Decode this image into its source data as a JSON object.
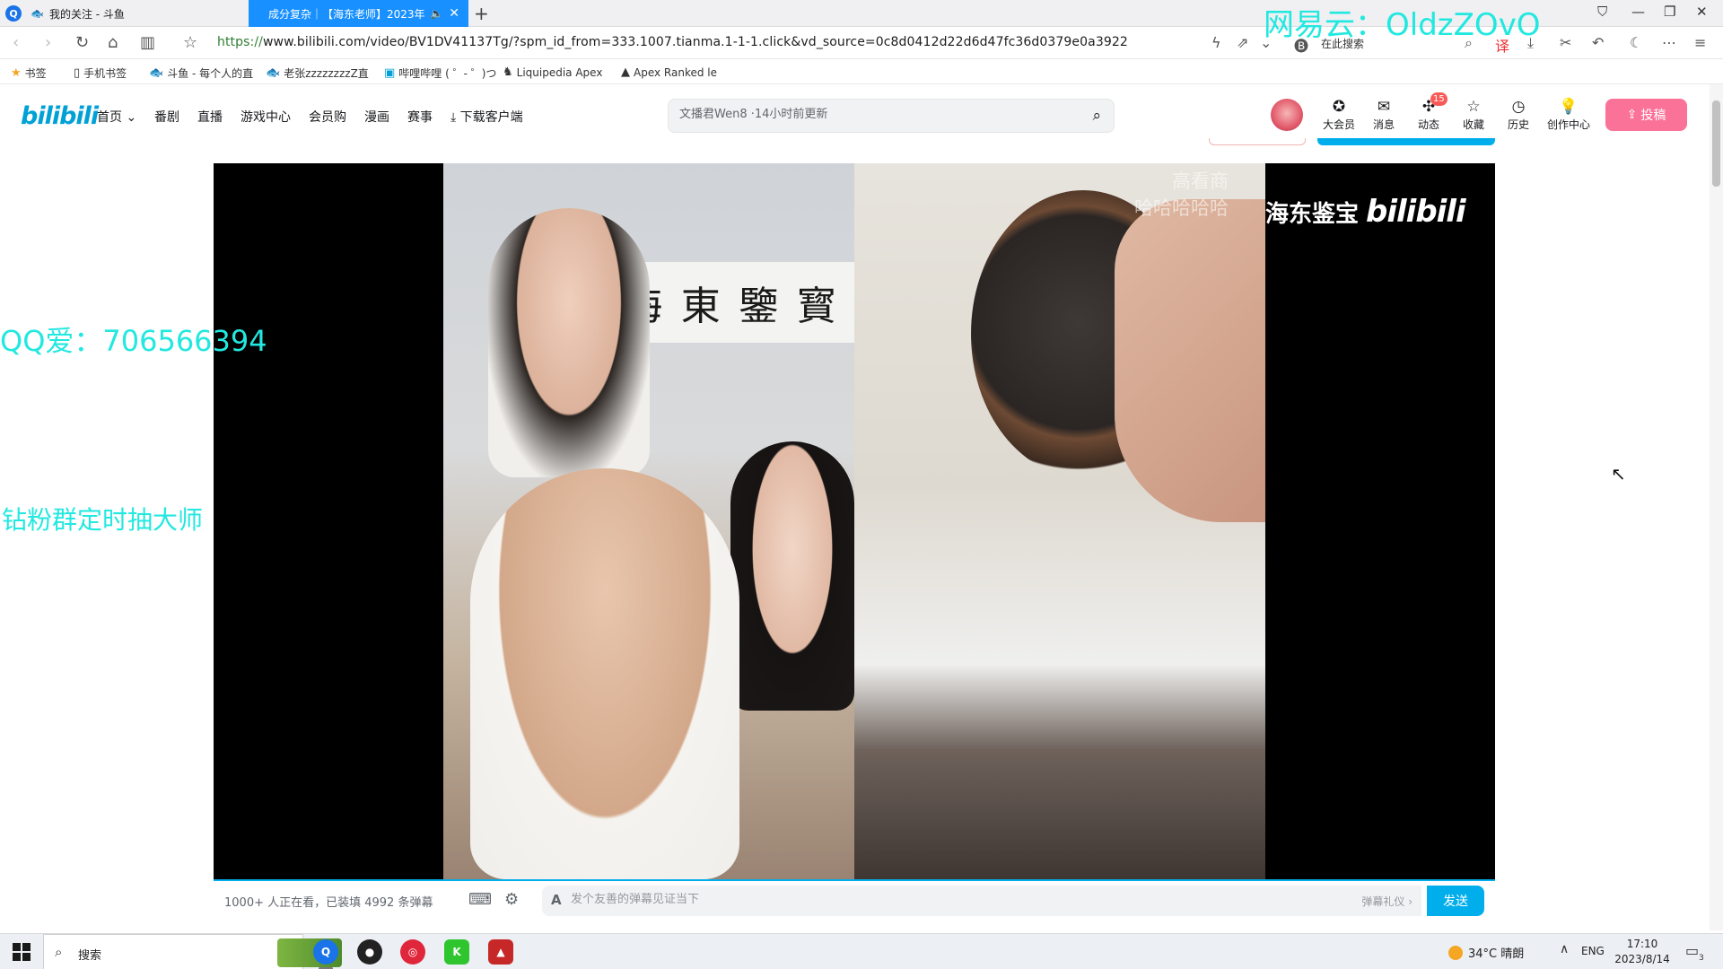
{
  "browser": {
    "tabs": [
      {
        "label": "我的关注 - 斗鱼",
        "active": false
      },
      {
        "label": "成分复杂｜【海东老师】2023年",
        "active": true
      }
    ],
    "url_scheme": "https://",
    "url_rest": "www.bilibili.com/video/BV1DV41137Tg/?spm_id_from=333.1007.tianma.1-1-1.click&vd_source=0c8d0412d22d6d47fc36d0379e0a3922",
    "search_engine_label": "在此搜索",
    "bookmarks": [
      {
        "label": "书签",
        "icon": "star-icon"
      },
      {
        "label": "手机书签",
        "icon": "phone-icon"
      },
      {
        "label": "斗鱼 - 每个人的直",
        "icon": "douyu-icon"
      },
      {
        "label": "老张zzzzzzzzZ直",
        "icon": "douyu-icon"
      },
      {
        "label": "哔哩哔哩 ( ゜- ゜)つ",
        "icon": "bilibili-icon"
      },
      {
        "label": "Liquipedia Apex",
        "icon": "liquipedia-icon"
      },
      {
        "label": "Apex Ranked le",
        "icon": "apex-icon"
      }
    ]
  },
  "bili": {
    "logo": "bilibili",
    "nav": [
      {
        "label": "首页"
      },
      {
        "label": "番剧"
      },
      {
        "label": "直播"
      },
      {
        "label": "游戏中心"
      },
      {
        "label": "会员购"
      },
      {
        "label": "漫画"
      },
      {
        "label": "赛事"
      },
      {
        "label": "下载客户端"
      }
    ],
    "search_placeholder": "文播君Wen8 ·14小时前更新",
    "header_items": [
      {
        "label": "大会员",
        "icon": "vip-icon"
      },
      {
        "label": "消息",
        "icon": "message-icon"
      },
      {
        "label": "动态",
        "icon": "dynamic-icon"
      },
      {
        "label": "收藏",
        "icon": "favorite-icon"
      },
      {
        "label": "历史",
        "icon": "history-icon"
      },
      {
        "label": "创作中心",
        "icon": "creator-icon"
      }
    ],
    "notif_badge": "15",
    "upload_label": "投稿"
  },
  "player": {
    "calligraphy": [
      "海",
      "東",
      "鑒",
      "寳"
    ],
    "watermark": "海东鉴宝",
    "watermark_logo": "bilibili",
    "faint_overlay": [
      "高看商",
      "哈哈哈哈哈"
    ]
  },
  "danmaku": {
    "viewer_info": "1000+ 人正在看，已装填 4992 条弹幕",
    "input_placeholder": "发个友善的弹幕见证当下",
    "etiquette": "弹幕礼仪 ›",
    "send_label": "发送"
  },
  "overlays": {
    "qq": "QQ爱：706566394",
    "fans": "钻粉群定时抽大师",
    "netease": "网易云：OldzZOvO"
  },
  "taskbar": {
    "search_label": "搜索",
    "weather": "34°C  晴朗",
    "lang": "ENG",
    "time": "17:10",
    "date": "2023/8/14",
    "notif_count": "3"
  },
  "colors": {
    "bili_blue": "#00aeec",
    "bili_pink": "#fb7299",
    "overlay_cyan": "#22e8e0",
    "active_tab": "#1890ff"
  }
}
